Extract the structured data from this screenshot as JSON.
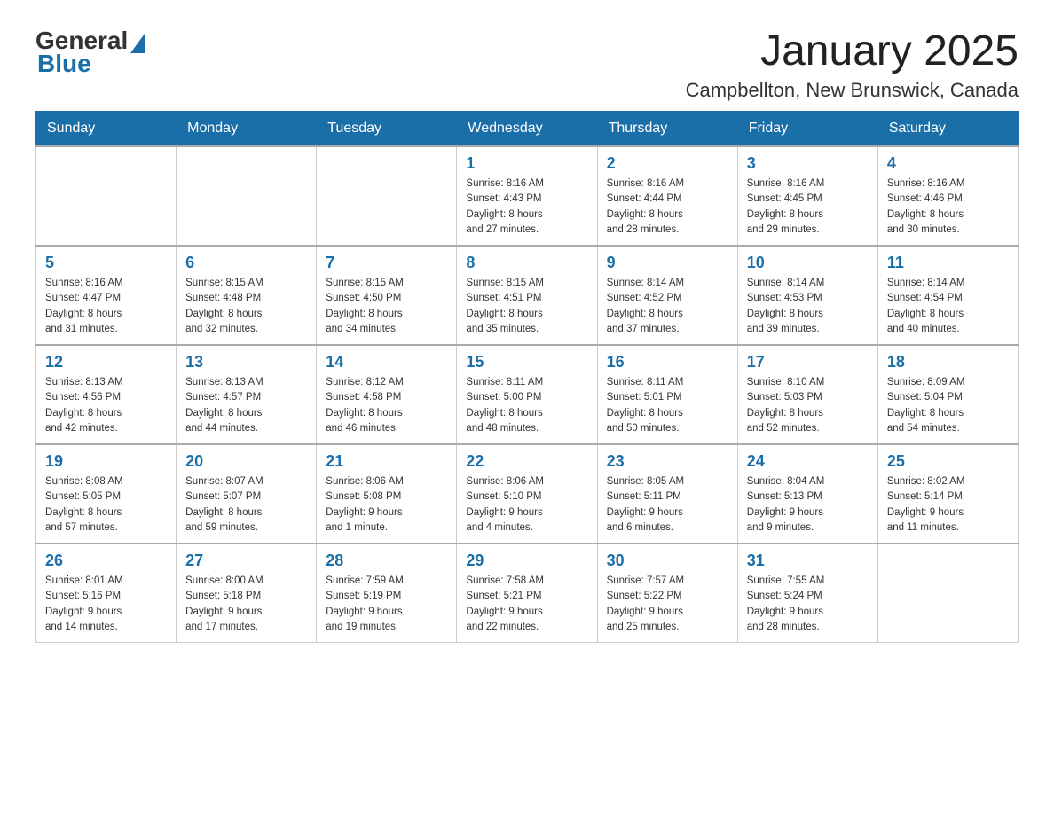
{
  "header": {
    "logo_general": "General",
    "logo_blue": "Blue",
    "month_title": "January 2025",
    "location": "Campbellton, New Brunswick, Canada"
  },
  "weekdays": [
    "Sunday",
    "Monday",
    "Tuesday",
    "Wednesday",
    "Thursday",
    "Friday",
    "Saturday"
  ],
  "weeks": [
    [
      {
        "day": "",
        "info": ""
      },
      {
        "day": "",
        "info": ""
      },
      {
        "day": "",
        "info": ""
      },
      {
        "day": "1",
        "info": "Sunrise: 8:16 AM\nSunset: 4:43 PM\nDaylight: 8 hours\nand 27 minutes."
      },
      {
        "day": "2",
        "info": "Sunrise: 8:16 AM\nSunset: 4:44 PM\nDaylight: 8 hours\nand 28 minutes."
      },
      {
        "day": "3",
        "info": "Sunrise: 8:16 AM\nSunset: 4:45 PM\nDaylight: 8 hours\nand 29 minutes."
      },
      {
        "day": "4",
        "info": "Sunrise: 8:16 AM\nSunset: 4:46 PM\nDaylight: 8 hours\nand 30 minutes."
      }
    ],
    [
      {
        "day": "5",
        "info": "Sunrise: 8:16 AM\nSunset: 4:47 PM\nDaylight: 8 hours\nand 31 minutes."
      },
      {
        "day": "6",
        "info": "Sunrise: 8:15 AM\nSunset: 4:48 PM\nDaylight: 8 hours\nand 32 minutes."
      },
      {
        "day": "7",
        "info": "Sunrise: 8:15 AM\nSunset: 4:50 PM\nDaylight: 8 hours\nand 34 minutes."
      },
      {
        "day": "8",
        "info": "Sunrise: 8:15 AM\nSunset: 4:51 PM\nDaylight: 8 hours\nand 35 minutes."
      },
      {
        "day": "9",
        "info": "Sunrise: 8:14 AM\nSunset: 4:52 PM\nDaylight: 8 hours\nand 37 minutes."
      },
      {
        "day": "10",
        "info": "Sunrise: 8:14 AM\nSunset: 4:53 PM\nDaylight: 8 hours\nand 39 minutes."
      },
      {
        "day": "11",
        "info": "Sunrise: 8:14 AM\nSunset: 4:54 PM\nDaylight: 8 hours\nand 40 minutes."
      }
    ],
    [
      {
        "day": "12",
        "info": "Sunrise: 8:13 AM\nSunset: 4:56 PM\nDaylight: 8 hours\nand 42 minutes."
      },
      {
        "day": "13",
        "info": "Sunrise: 8:13 AM\nSunset: 4:57 PM\nDaylight: 8 hours\nand 44 minutes."
      },
      {
        "day": "14",
        "info": "Sunrise: 8:12 AM\nSunset: 4:58 PM\nDaylight: 8 hours\nand 46 minutes."
      },
      {
        "day": "15",
        "info": "Sunrise: 8:11 AM\nSunset: 5:00 PM\nDaylight: 8 hours\nand 48 minutes."
      },
      {
        "day": "16",
        "info": "Sunrise: 8:11 AM\nSunset: 5:01 PM\nDaylight: 8 hours\nand 50 minutes."
      },
      {
        "day": "17",
        "info": "Sunrise: 8:10 AM\nSunset: 5:03 PM\nDaylight: 8 hours\nand 52 minutes."
      },
      {
        "day": "18",
        "info": "Sunrise: 8:09 AM\nSunset: 5:04 PM\nDaylight: 8 hours\nand 54 minutes."
      }
    ],
    [
      {
        "day": "19",
        "info": "Sunrise: 8:08 AM\nSunset: 5:05 PM\nDaylight: 8 hours\nand 57 minutes."
      },
      {
        "day": "20",
        "info": "Sunrise: 8:07 AM\nSunset: 5:07 PM\nDaylight: 8 hours\nand 59 minutes."
      },
      {
        "day": "21",
        "info": "Sunrise: 8:06 AM\nSunset: 5:08 PM\nDaylight: 9 hours\nand 1 minute."
      },
      {
        "day": "22",
        "info": "Sunrise: 8:06 AM\nSunset: 5:10 PM\nDaylight: 9 hours\nand 4 minutes."
      },
      {
        "day": "23",
        "info": "Sunrise: 8:05 AM\nSunset: 5:11 PM\nDaylight: 9 hours\nand 6 minutes."
      },
      {
        "day": "24",
        "info": "Sunrise: 8:04 AM\nSunset: 5:13 PM\nDaylight: 9 hours\nand 9 minutes."
      },
      {
        "day": "25",
        "info": "Sunrise: 8:02 AM\nSunset: 5:14 PM\nDaylight: 9 hours\nand 11 minutes."
      }
    ],
    [
      {
        "day": "26",
        "info": "Sunrise: 8:01 AM\nSunset: 5:16 PM\nDaylight: 9 hours\nand 14 minutes."
      },
      {
        "day": "27",
        "info": "Sunrise: 8:00 AM\nSunset: 5:18 PM\nDaylight: 9 hours\nand 17 minutes."
      },
      {
        "day": "28",
        "info": "Sunrise: 7:59 AM\nSunset: 5:19 PM\nDaylight: 9 hours\nand 19 minutes."
      },
      {
        "day": "29",
        "info": "Sunrise: 7:58 AM\nSunset: 5:21 PM\nDaylight: 9 hours\nand 22 minutes."
      },
      {
        "day": "30",
        "info": "Sunrise: 7:57 AM\nSunset: 5:22 PM\nDaylight: 9 hours\nand 25 minutes."
      },
      {
        "day": "31",
        "info": "Sunrise: 7:55 AM\nSunset: 5:24 PM\nDaylight: 9 hours\nand 28 minutes."
      },
      {
        "day": "",
        "info": ""
      }
    ]
  ]
}
